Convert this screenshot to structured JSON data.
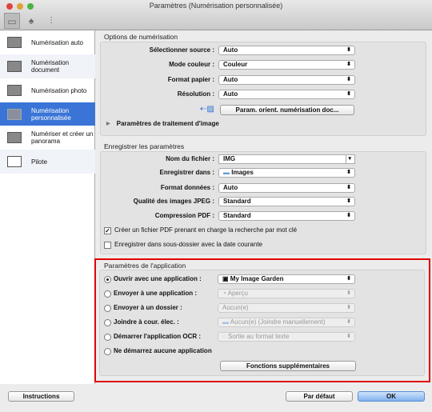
{
  "window": {
    "title": "Paramètres (Numérisation personnalisée)"
  },
  "toolbar": [
    "scanner-icon",
    "network-icon",
    "general-settings-icon"
  ],
  "sidebar": {
    "items": [
      {
        "label": "Numérisation auto",
        "icon": "auto-scan-icon"
      },
      {
        "label": "Numérisation document",
        "icon": "pdf-document-icon"
      },
      {
        "label": "Numérisation photo",
        "icon": "photo-icon"
      },
      {
        "label": "Numérisation personnalisée",
        "icon": "custom-scan-icon",
        "selected": true
      },
      {
        "label": "Numériser et créer un panorama",
        "icon": "panorama-icon"
      },
      {
        "label": "Pilote",
        "icon": "driver-icon"
      }
    ]
  },
  "scan_options": {
    "title": "Options de numérisation",
    "rows": [
      {
        "label": "Sélectionner source :",
        "value": "Auto"
      },
      {
        "label": "Mode couleur :",
        "value": "Couleur"
      },
      {
        "label": "Format papier :",
        "value": "Auto"
      },
      {
        "label": "Résolution :",
        "value": "Auto"
      }
    ],
    "orient_button": "Param. orient. numérisation doc...",
    "image_processing": "Paramètres de traitement d'image"
  },
  "save_settings": {
    "title": "Enregistrer les paramètres",
    "filename_label": "Nom du fichier :",
    "filename_value": "IMG",
    "rows": [
      {
        "label": "Enregistrer dans :",
        "value": "Images"
      },
      {
        "label": "Format données :",
        "value": "Auto"
      },
      {
        "label": "Qualité des images JPEG :",
        "value": "Standard"
      },
      {
        "label": "Compression PDF :",
        "value": "Standard"
      }
    ],
    "checkbox1": {
      "label": "Créer un fichier PDF prenant en charge la recherche par mot clé",
      "checked": true
    },
    "checkbox2": {
      "label": "Enregistrer dans sous-dossier avec la date courante",
      "checked": false
    }
  },
  "app_settings": {
    "title": "Paramètres de l'application",
    "rows": [
      {
        "label": "Ouvrir avec une application :",
        "value": "My Image Garden",
        "selected": true,
        "enabled": true
      },
      {
        "label": "Envoyer à une application :",
        "value": "Aperçu",
        "enabled": false
      },
      {
        "label": "Envoyer à un dossier :",
        "value": "Aucun(e)",
        "enabled": false
      },
      {
        "label": "Joindre à cour. élec. :",
        "value": "Aucun(e) (Joindre manuellement)",
        "enabled": false
      },
      {
        "label": "Démarrer l'application OCR :",
        "value": "Sortie au format texte",
        "enabled": false
      },
      {
        "label": "Ne démarrez aucune application"
      }
    ],
    "more_button": "Fonctions supplémentaires"
  },
  "footer": {
    "instructions": "Instructions",
    "default": "Par défaut",
    "ok": "OK"
  },
  "colors": {
    "selection": "#3a74d6",
    "highlight": "#e00000"
  }
}
